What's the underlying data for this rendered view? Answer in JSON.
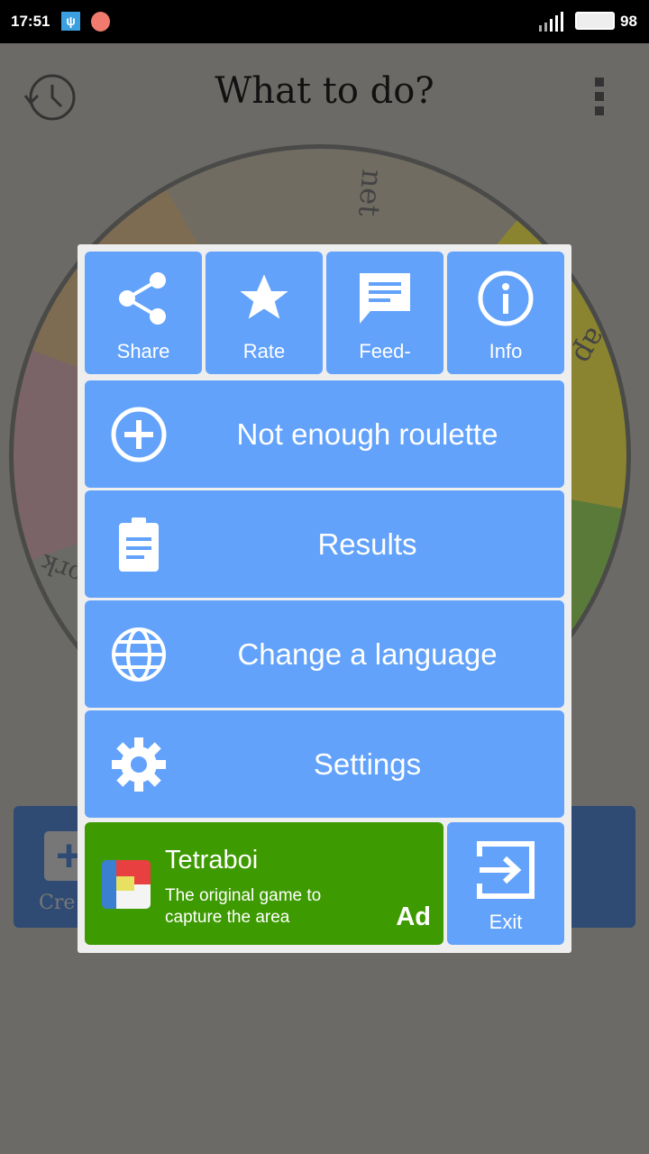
{
  "status_bar": {
    "time": "17:51",
    "battery": "98"
  },
  "header": {
    "title": "What to do?",
    "history_icon": "history-icon",
    "menu_icon": "more-vert-icon"
  },
  "wheel": {
    "labels": [
      "net",
      "ap",
      "ork"
    ]
  },
  "background_button": {
    "label": "Cre"
  },
  "dialog": {
    "top_buttons": [
      {
        "label": "Share",
        "icon": "share-icon"
      },
      {
        "label": "Rate",
        "icon": "star-icon"
      },
      {
        "label": "Feed-",
        "icon": "feedback-icon"
      },
      {
        "label": "Info",
        "icon": "info-icon"
      }
    ],
    "menu_items": [
      {
        "label": "Not enough roulette",
        "icon": "add-circle-icon"
      },
      {
        "label": "Results",
        "icon": "clipboard-icon"
      },
      {
        "label": "Change a language",
        "icon": "globe-icon"
      },
      {
        "label": "Settings",
        "icon": "gear-icon"
      }
    ],
    "ad": {
      "title": "Tetraboi",
      "description": "The original game to capture the area",
      "badge": "Ad"
    },
    "exit": {
      "label": "Exit",
      "icon": "exit-icon"
    },
    "colors": {
      "button": "#62a2fb",
      "ad": "#3d9a00"
    }
  }
}
